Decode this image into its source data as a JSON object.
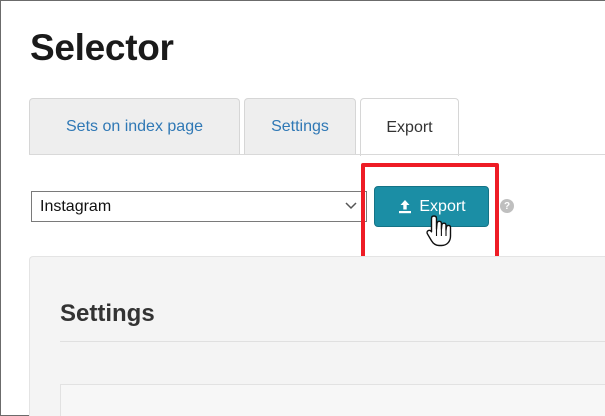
{
  "page": {
    "title": "Selector"
  },
  "tabs": [
    {
      "label": "Sets on index page",
      "active": false
    },
    {
      "label": "Settings",
      "active": false
    },
    {
      "label": "Export",
      "active": true
    }
  ],
  "toolbar": {
    "select_value": "Instagram",
    "export_label": "Export",
    "help_symbol": "?"
  },
  "panel": {
    "title": "Settings"
  },
  "icons": {
    "upload": "upload-icon",
    "dropdown": "chevron-down-icon",
    "help": "question-circle-icon",
    "cursor": "hand-pointer-icon"
  },
  "colors": {
    "accent_button": "#1b8ea5",
    "highlight_box": "#ee1c25",
    "tab_link": "#2f78b5"
  }
}
